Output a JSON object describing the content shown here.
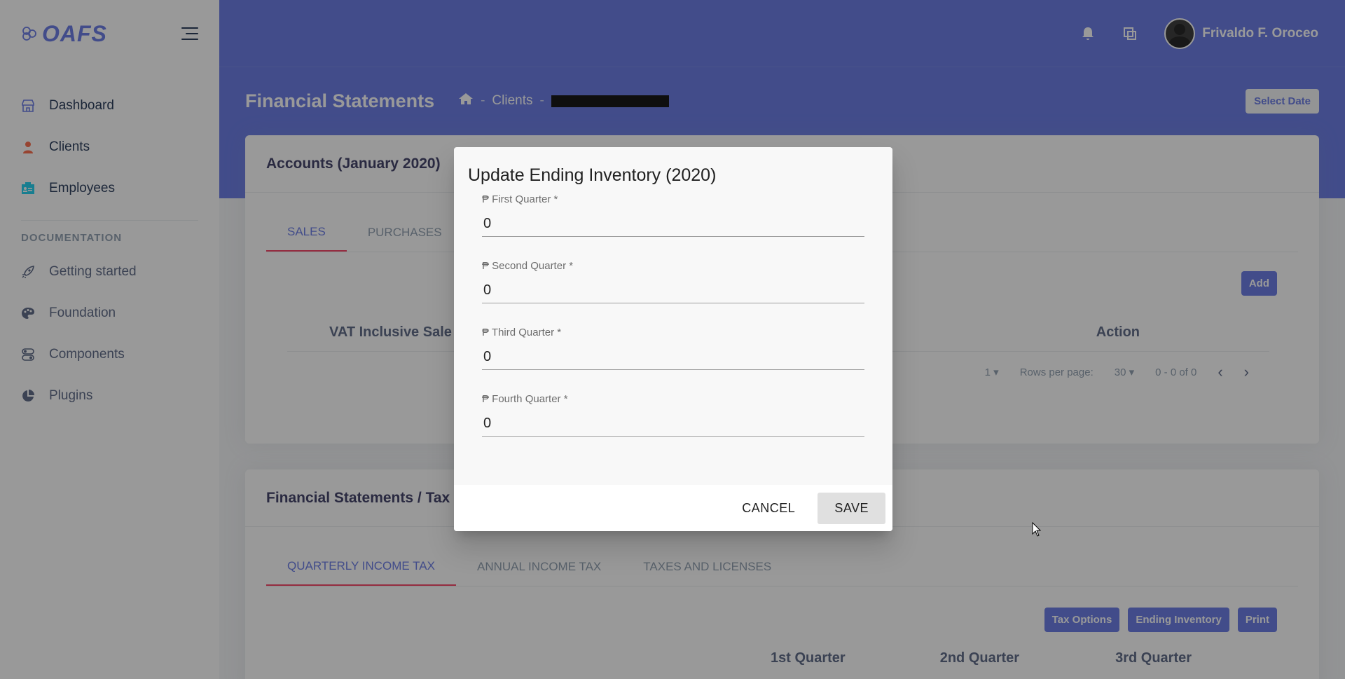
{
  "app": {
    "logo": "OAFS"
  },
  "sidebar": {
    "items": [
      {
        "label": "Dashboard",
        "icon": "shop-icon",
        "color": "#5e72e4"
      },
      {
        "label": "Clients",
        "icon": "user-icon",
        "color": "#fb6340"
      },
      {
        "label": "Employees",
        "icon": "badge-icon",
        "color": "#11cdef"
      }
    ],
    "doc_heading": "DOCUMENTATION",
    "doc_items": [
      {
        "label": "Getting started",
        "icon": "rocket-icon"
      },
      {
        "label": "Foundation",
        "icon": "palette-icon"
      },
      {
        "label": "Components",
        "icon": "components-icon"
      },
      {
        "label": "Plugins",
        "icon": "chart-pie-icon"
      }
    ]
  },
  "header": {
    "user_name": "Frivaldo F. Oroceo",
    "page_title": "Financial Statements",
    "breadcrumb": [
      "Clients"
    ],
    "select_date": "Select Date"
  },
  "accounts_card": {
    "title": "Accounts (January 2020)",
    "tabs": [
      "SALES",
      "PURCHASES"
    ],
    "add_label": "Add",
    "columns": [
      "VAT Inclusive Sale",
      "Action"
    ],
    "pagination": {
      "page": "1",
      "rows_per_page_label": "Rows per page:",
      "rows_per_page": "30",
      "range": "0 - 0 of 0"
    }
  },
  "tax_card": {
    "title": "Financial Statements / Tax",
    "tabs": [
      "QUARTERLY INCOME TAX",
      "ANNUAL INCOME TAX",
      "TAXES AND LICENSES"
    ],
    "buttons": [
      "Tax Options",
      "Ending Inventory",
      "Print"
    ],
    "columns": [
      "1st Quarter",
      "2nd Quarter",
      "3rd Quarter"
    ]
  },
  "dialog": {
    "title": "Update Ending Inventory (2020)",
    "fields": [
      {
        "label": "₱ First Quarter *",
        "value": "0"
      },
      {
        "label": "₱ Second Quarter *",
        "value": "0"
      },
      {
        "label": "₱ Third Quarter *",
        "value": "0"
      },
      {
        "label": "₱ Fourth Quarter *",
        "value": "0"
      }
    ],
    "cancel": "CANCEL",
    "save": "SAVE"
  },
  "colors": {
    "primary": "#5e72e4",
    "danger": "#f5365c",
    "warning": "#fb6340",
    "info": "#11cdef"
  }
}
